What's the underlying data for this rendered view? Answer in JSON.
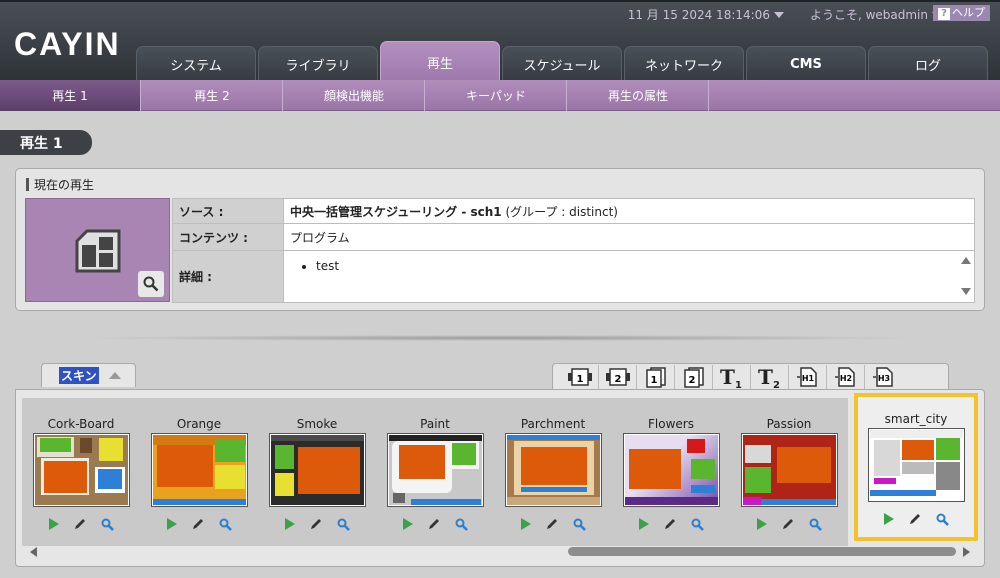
{
  "header": {
    "logo": "CAYIN",
    "datetime": "11 月 15 2024 18:14:06",
    "welcome": "ようこそ, webadmin",
    "help_label": "ヘルプ",
    "help_mark": "?"
  },
  "tabs": [
    "システム",
    "ライブラリ",
    "再生",
    "スケジュール",
    "ネットワーク",
    "CMS",
    "ログ"
  ],
  "subtabs": [
    "再生 1",
    "再生 2",
    "顔検出機能",
    "キーパッド",
    "再生の属性"
  ],
  "page_title": "再生 1",
  "current": {
    "title": "現在の再生",
    "source_label": "ソース :",
    "source_value_bold": "中央一括管理スケジューリング - sch1",
    "source_group": "(グループ : distinct)",
    "content_label": "コンテンツ :",
    "content_value": "プログラム",
    "details_label": "詳細 :",
    "details_items": [
      "test"
    ]
  },
  "skin_tab_label": "スキン",
  "toolbar_icons": [
    "layout-1-icon",
    "layout-2-icon",
    "layout-3-icon",
    "layout-4-icon",
    "text-1-icon",
    "text-2-icon",
    "html-1-icon",
    "html-2-icon",
    "html-3-icon"
  ],
  "skins": [
    {
      "name": "Cork-Board",
      "bg": "#9c7a4f",
      "selected": false
    },
    {
      "name": "Orange",
      "bg": "#e8a21c",
      "selected": false
    },
    {
      "name": "Smoke",
      "bg": "#2b2b2b",
      "selected": false
    },
    {
      "name": "Paint",
      "bg": "#cfcfcf",
      "selected": false
    },
    {
      "name": "Parchment",
      "bg": "#a87a4a",
      "selected": false
    },
    {
      "name": "Flowers",
      "bg": "#d8cde6",
      "selected": false
    },
    {
      "name": "Passion",
      "bg": "#b02418",
      "selected": false
    },
    {
      "name": "smart_city",
      "bg": "#ffffff",
      "selected": true
    }
  ],
  "colors": {
    "accent": "#9d78ab",
    "header": "#2e3338",
    "selected_border": "#f2c32a",
    "zone": "#dc5a0a"
  }
}
